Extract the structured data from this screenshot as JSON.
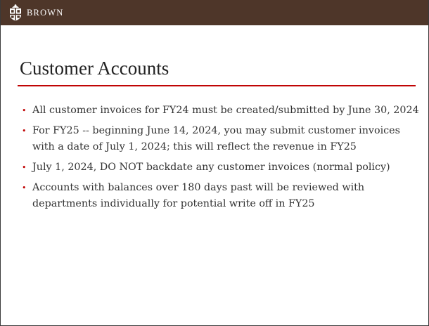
{
  "header": {
    "logo_icon": "brown-university-shield-icon",
    "wordmark": "BROWN",
    "bar_color": "#4e3629"
  },
  "slide": {
    "title": "Customer Accounts",
    "accent_color": "#c00404",
    "bullets": [
      "All customer invoices for FY24 must be created/submitted by June 30, 2024",
      "For FY25 -- beginning June 14, 2024, you may submit customer invoices with a date of July 1, 2024; this will reflect the revenue in FY25",
      "July 1, 2024, DO NOT backdate any customer invoices (normal policy)",
      "Accounts with balances over 180 days past will be reviewed with departments individually for potential write off in FY25"
    ]
  }
}
